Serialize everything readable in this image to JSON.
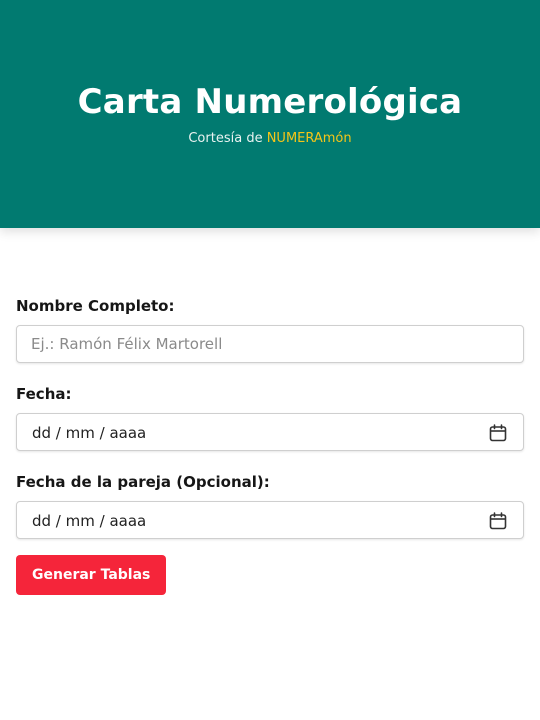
{
  "header": {
    "title": "Carta Numerológica",
    "subtitle_prefix": "Cortesía de ",
    "subtitle_brand": "NUMERAmón"
  },
  "form": {
    "name_label": "Nombre Completo:",
    "name_placeholder": "Ej.: Ramón Félix Martorell",
    "name_value": "",
    "date_label": "Fecha:",
    "date_placeholder": "dd / mm / aaaa",
    "partner_date_label": "Fecha de la pareja (Opcional):",
    "partner_date_placeholder": "dd / mm / aaaa",
    "submit_label": "Generar Tablas",
    "calendar_icon": "calendar-icon"
  },
  "colors": {
    "header_bg": "#017a70",
    "brand": "#f5c518",
    "button_bg": "#f5253a"
  }
}
